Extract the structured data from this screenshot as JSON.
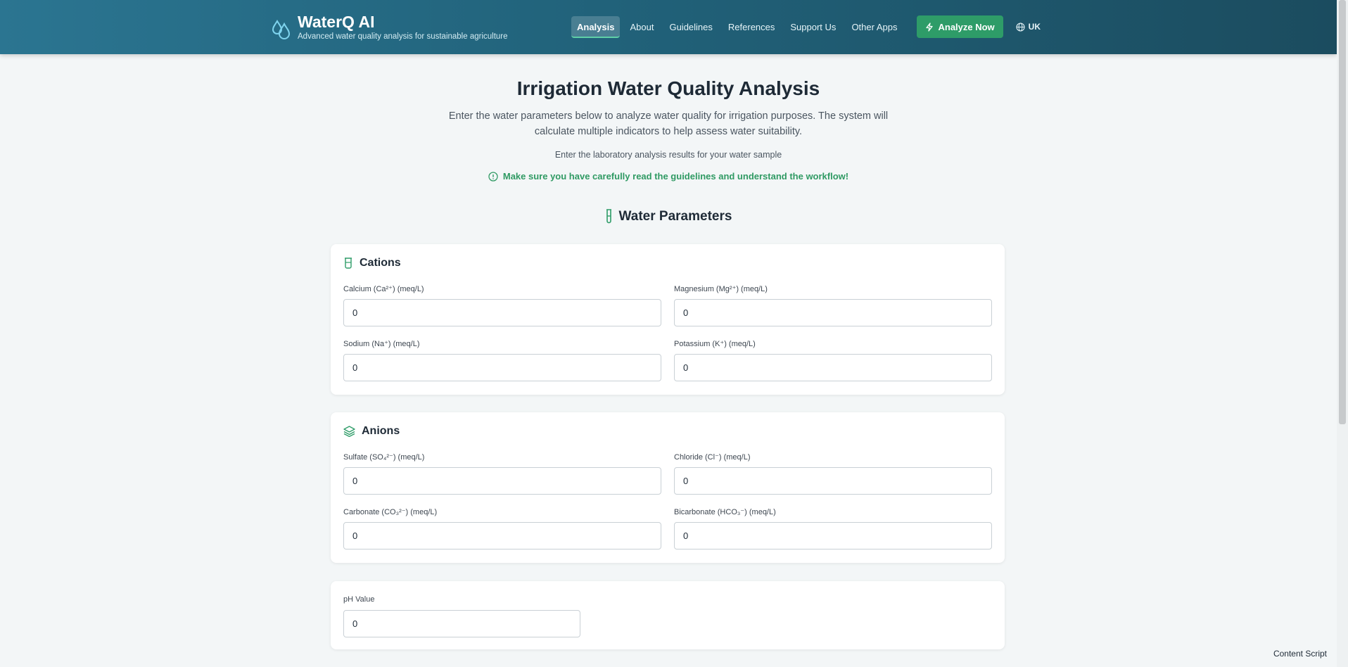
{
  "brand": {
    "title": "WaterQ AI",
    "subtitle": "Advanced water quality analysis for sustainable agriculture",
    "icon": "water-drops-icon"
  },
  "nav": {
    "items": [
      {
        "label": "Analysis",
        "active": true
      },
      {
        "label": "About"
      },
      {
        "label": "Guidelines"
      },
      {
        "label": "References"
      },
      {
        "label": "Support Us"
      },
      {
        "label": "Other Apps"
      }
    ],
    "analyze_label": "Analyze Now",
    "analyze_icon": "lightning-icon",
    "language_label": "UK",
    "language_icon": "globe-icon"
  },
  "intro": {
    "title": "Irrigation Water Quality Analysis",
    "description": "Enter the water parameters below to analyze water quality for irrigation purposes. The system will calculate multiple indicators to help assess water suitability.",
    "subtitle": "Enter the laboratory analysis results for your water sample",
    "warning": "Make sure you have carefully read the guidelines and understand the workflow!"
  },
  "section": {
    "title": "Water Parameters",
    "icon": "test-tube-icon"
  },
  "cations": {
    "title": "Cations",
    "icon": "beaker-icon",
    "fields": [
      {
        "label": "Calcium (Ca²⁺) (meq/L)",
        "value": "0"
      },
      {
        "label": "Magnesium (Mg²⁺) (meq/L)",
        "value": "0"
      },
      {
        "label": "Sodium (Na⁺) (meq/L)",
        "value": "0"
      },
      {
        "label": "Potassium (K⁺) (meq/L)",
        "value": "0"
      }
    ]
  },
  "anions": {
    "title": "Anions",
    "icon": "layers-icon",
    "fields": [
      {
        "label": "Sulfate (SO₄²⁻) (meq/L)",
        "value": "0"
      },
      {
        "label": "Chloride (Cl⁻) (meq/L)",
        "value": "0"
      },
      {
        "label": "Carbonate (CO₃²⁻) (meq/L)",
        "value": "0"
      },
      {
        "label": "Bicarbonate (HCO₃⁻) (meq/L)",
        "value": "0"
      }
    ]
  },
  "ph": {
    "label": "pH Value",
    "value": "0"
  },
  "footer": {
    "note": "Content Script"
  },
  "colors": {
    "accent": "#2e9c68",
    "header_start": "#2b7591",
    "header_end": "#1b4c5f"
  }
}
